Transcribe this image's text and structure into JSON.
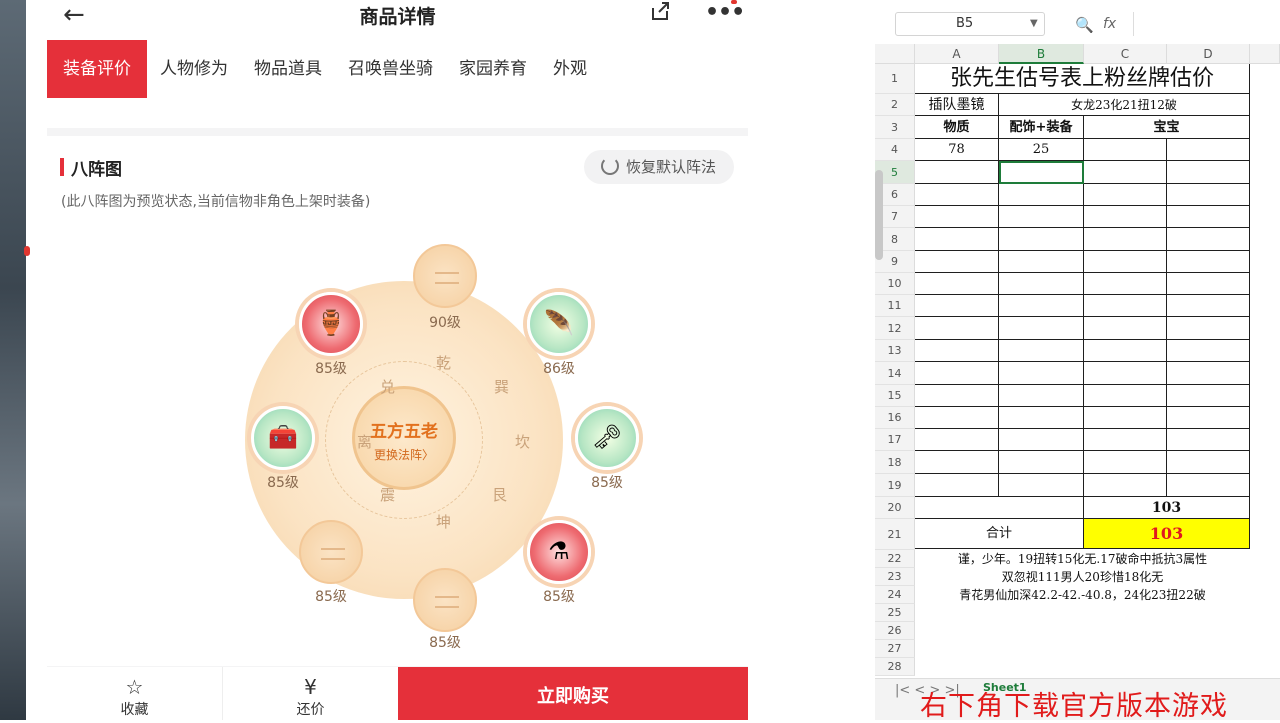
{
  "app": {
    "title": "商品详情",
    "tabs": [
      "装备评价",
      "人物修为",
      "物品道具",
      "召唤兽坐骑",
      "家园养育",
      "外观"
    ],
    "section_title": "八阵图",
    "restore_label": "恢复默认阵法",
    "note": "(此八阵图为预览状态,当前信物非角色上架时装备)",
    "center_title": "五方五老",
    "center_sub": "更换法阵〉",
    "gua": [
      "乾",
      "巽",
      "坎",
      "艮",
      "坤",
      "震",
      "离",
      "兑"
    ],
    "nodes": [
      {
        "level": "90级",
        "kind": "empty"
      },
      {
        "level": "86级",
        "kind": "green",
        "icon": "feather-icon"
      },
      {
        "level": "85级",
        "kind": "green",
        "icon": "wand-icon"
      },
      {
        "level": "85级",
        "kind": "red",
        "icon": "potion-icon"
      },
      {
        "level": "85级",
        "kind": "empty"
      },
      {
        "level": "85级",
        "kind": "empty"
      },
      {
        "level": "85级",
        "kind": "green",
        "icon": "treasure-icon"
      },
      {
        "level": "85级",
        "kind": "red",
        "icon": "vase-icon"
      }
    ],
    "bottom": {
      "collect": "收藏",
      "bargain": "还价",
      "buy": "立即购买"
    }
  },
  "sheet": {
    "namebox": "B5",
    "fx": "fx",
    "columns": [
      "A",
      "B",
      "C",
      "D"
    ],
    "rows": [
      "1",
      "2",
      "3",
      "4",
      "5",
      "6",
      "7",
      "8",
      "9",
      "10",
      "11",
      "12",
      "13",
      "14",
      "15",
      "16",
      "17",
      "18",
      "19",
      "20",
      "21",
      "22",
      "23",
      "24",
      "25",
      "26",
      "27",
      "28"
    ],
    "title": "张先生估号表上粉丝牌估价",
    "r2a": "插队墨镜",
    "r2b": "女龙23化21扭12破",
    "h_a": "物质",
    "h_b": "配饰+装备",
    "h_c": "宝宝",
    "v_a": "78",
    "v_b": "25",
    "r20": "103",
    "total_label": "合计",
    "total_value": "103",
    "note1": "谨，少年。19扭转15化无.17破命中抵抗3属性",
    "note2": "双忽视111男人20珍惜18化无",
    "note3": "青花男仙加深42.2-42.-40.8，24化23扭22破",
    "sheet_tab": "Sheet1"
  },
  "overlay": "右下角下载官方版本游戏",
  "colors": {
    "accent": "#e5303a",
    "excel_green": "#1e7c3a",
    "highlight": "#ffff00"
  }
}
